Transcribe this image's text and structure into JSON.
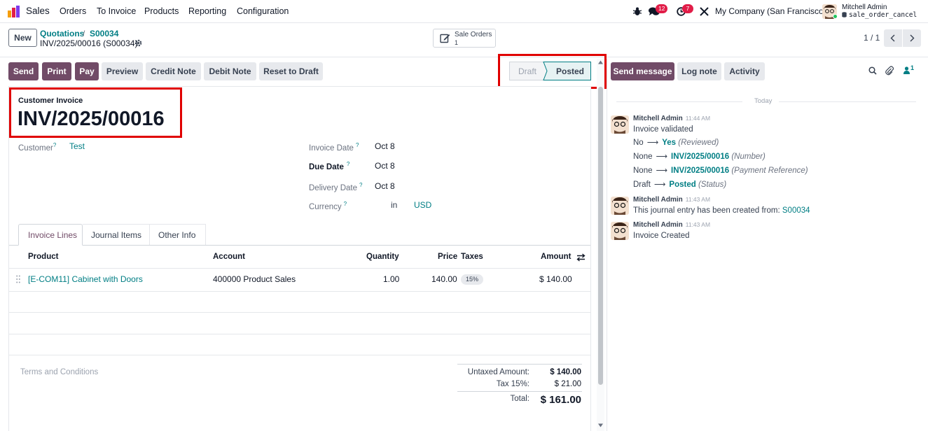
{
  "topnav": {
    "app_name": "Sales",
    "menu": [
      "Orders",
      "To Invoice",
      "Products",
      "Reporting",
      "Configuration"
    ],
    "messages_count": "12",
    "activities_count": "7",
    "company": "My Company (San Francisco)",
    "user_name": "Mitchell Admin",
    "user_db": "sale_order_cancel"
  },
  "control": {
    "new_label": "New",
    "breadcrumb_parent": "Quotations",
    "breadcrumb_sep": "/",
    "breadcrumb_current": "S00034",
    "record_name": "INV/2025/00016 (S00034)",
    "smart_button_label": "Sale Orders",
    "smart_button_count": "1",
    "pager": "1 / 1"
  },
  "actions": {
    "send": "Send",
    "print": "Print",
    "pay": "Pay",
    "preview": "Preview",
    "credit_note": "Credit Note",
    "debit_note": "Debit Note",
    "reset_to_draft": "Reset to Draft"
  },
  "status": {
    "draft": "Draft",
    "posted": "Posted"
  },
  "form": {
    "doc_type": "Customer Invoice",
    "number": "INV/2025/00016",
    "customer_label": "Customer",
    "customer_value": "Test",
    "invoice_date_label": "Invoice Date",
    "invoice_date_value": "Oct 8",
    "due_date_label": "Due Date",
    "due_date_value": "Oct 8",
    "delivery_date_label": "Delivery Date",
    "delivery_date_value": "Oct 8",
    "currency_label": "Currency",
    "currency_in": "in",
    "currency_value": "USD",
    "help_mark": "?"
  },
  "tabs": [
    "Invoice Lines",
    "Journal Items",
    "Other Info"
  ],
  "table": {
    "headers": {
      "product": "Product",
      "account": "Account",
      "quantity": "Quantity",
      "price": "Price",
      "taxes": "Taxes",
      "amount": "Amount"
    },
    "rows": [
      {
        "product": "[E-COM11] Cabinet with Doors",
        "account": "400000 Product Sales",
        "quantity": "1.00",
        "price": "140.00",
        "taxes": "15%",
        "amount": "$ 140.00"
      }
    ]
  },
  "footer": {
    "terms_placeholder": "Terms and Conditions",
    "untaxed_label": "Untaxed Amount:",
    "untaxed_value": "$ 140.00",
    "tax_label": "Tax 15%:",
    "tax_value": "$ 21.00",
    "total_label": "Total:",
    "total_value": "$ 161.00"
  },
  "chatter": {
    "send_message": "Send message",
    "log_note": "Log note",
    "activity": "Activity",
    "followers_count": "1",
    "date_separator": "Today",
    "messages": [
      {
        "author": "Mitchell Admin",
        "time": "11:44 AM",
        "body": "Invoice validated",
        "changes": [
          {
            "old": "No",
            "new": "Yes",
            "field": "(Reviewed)"
          },
          {
            "old": "None",
            "new": "INV/2025/00016",
            "field": "(Number)"
          },
          {
            "old": "None",
            "new": "INV/2025/00016",
            "field": "(Payment Reference)"
          },
          {
            "old": "Draft",
            "new": "Posted",
            "field": "(Status)"
          }
        ]
      },
      {
        "author": "Mitchell Admin",
        "time": "11:43 AM",
        "body": "This journal entry has been created from:",
        "link": "S00034"
      },
      {
        "author": "Mitchell Admin",
        "time": "11:43 AM",
        "body": "Invoice Created"
      }
    ]
  },
  "colors": {
    "primary": "#714b67",
    "link": "#017e84",
    "highlight": "#e00000",
    "badge": "#e11d48"
  }
}
